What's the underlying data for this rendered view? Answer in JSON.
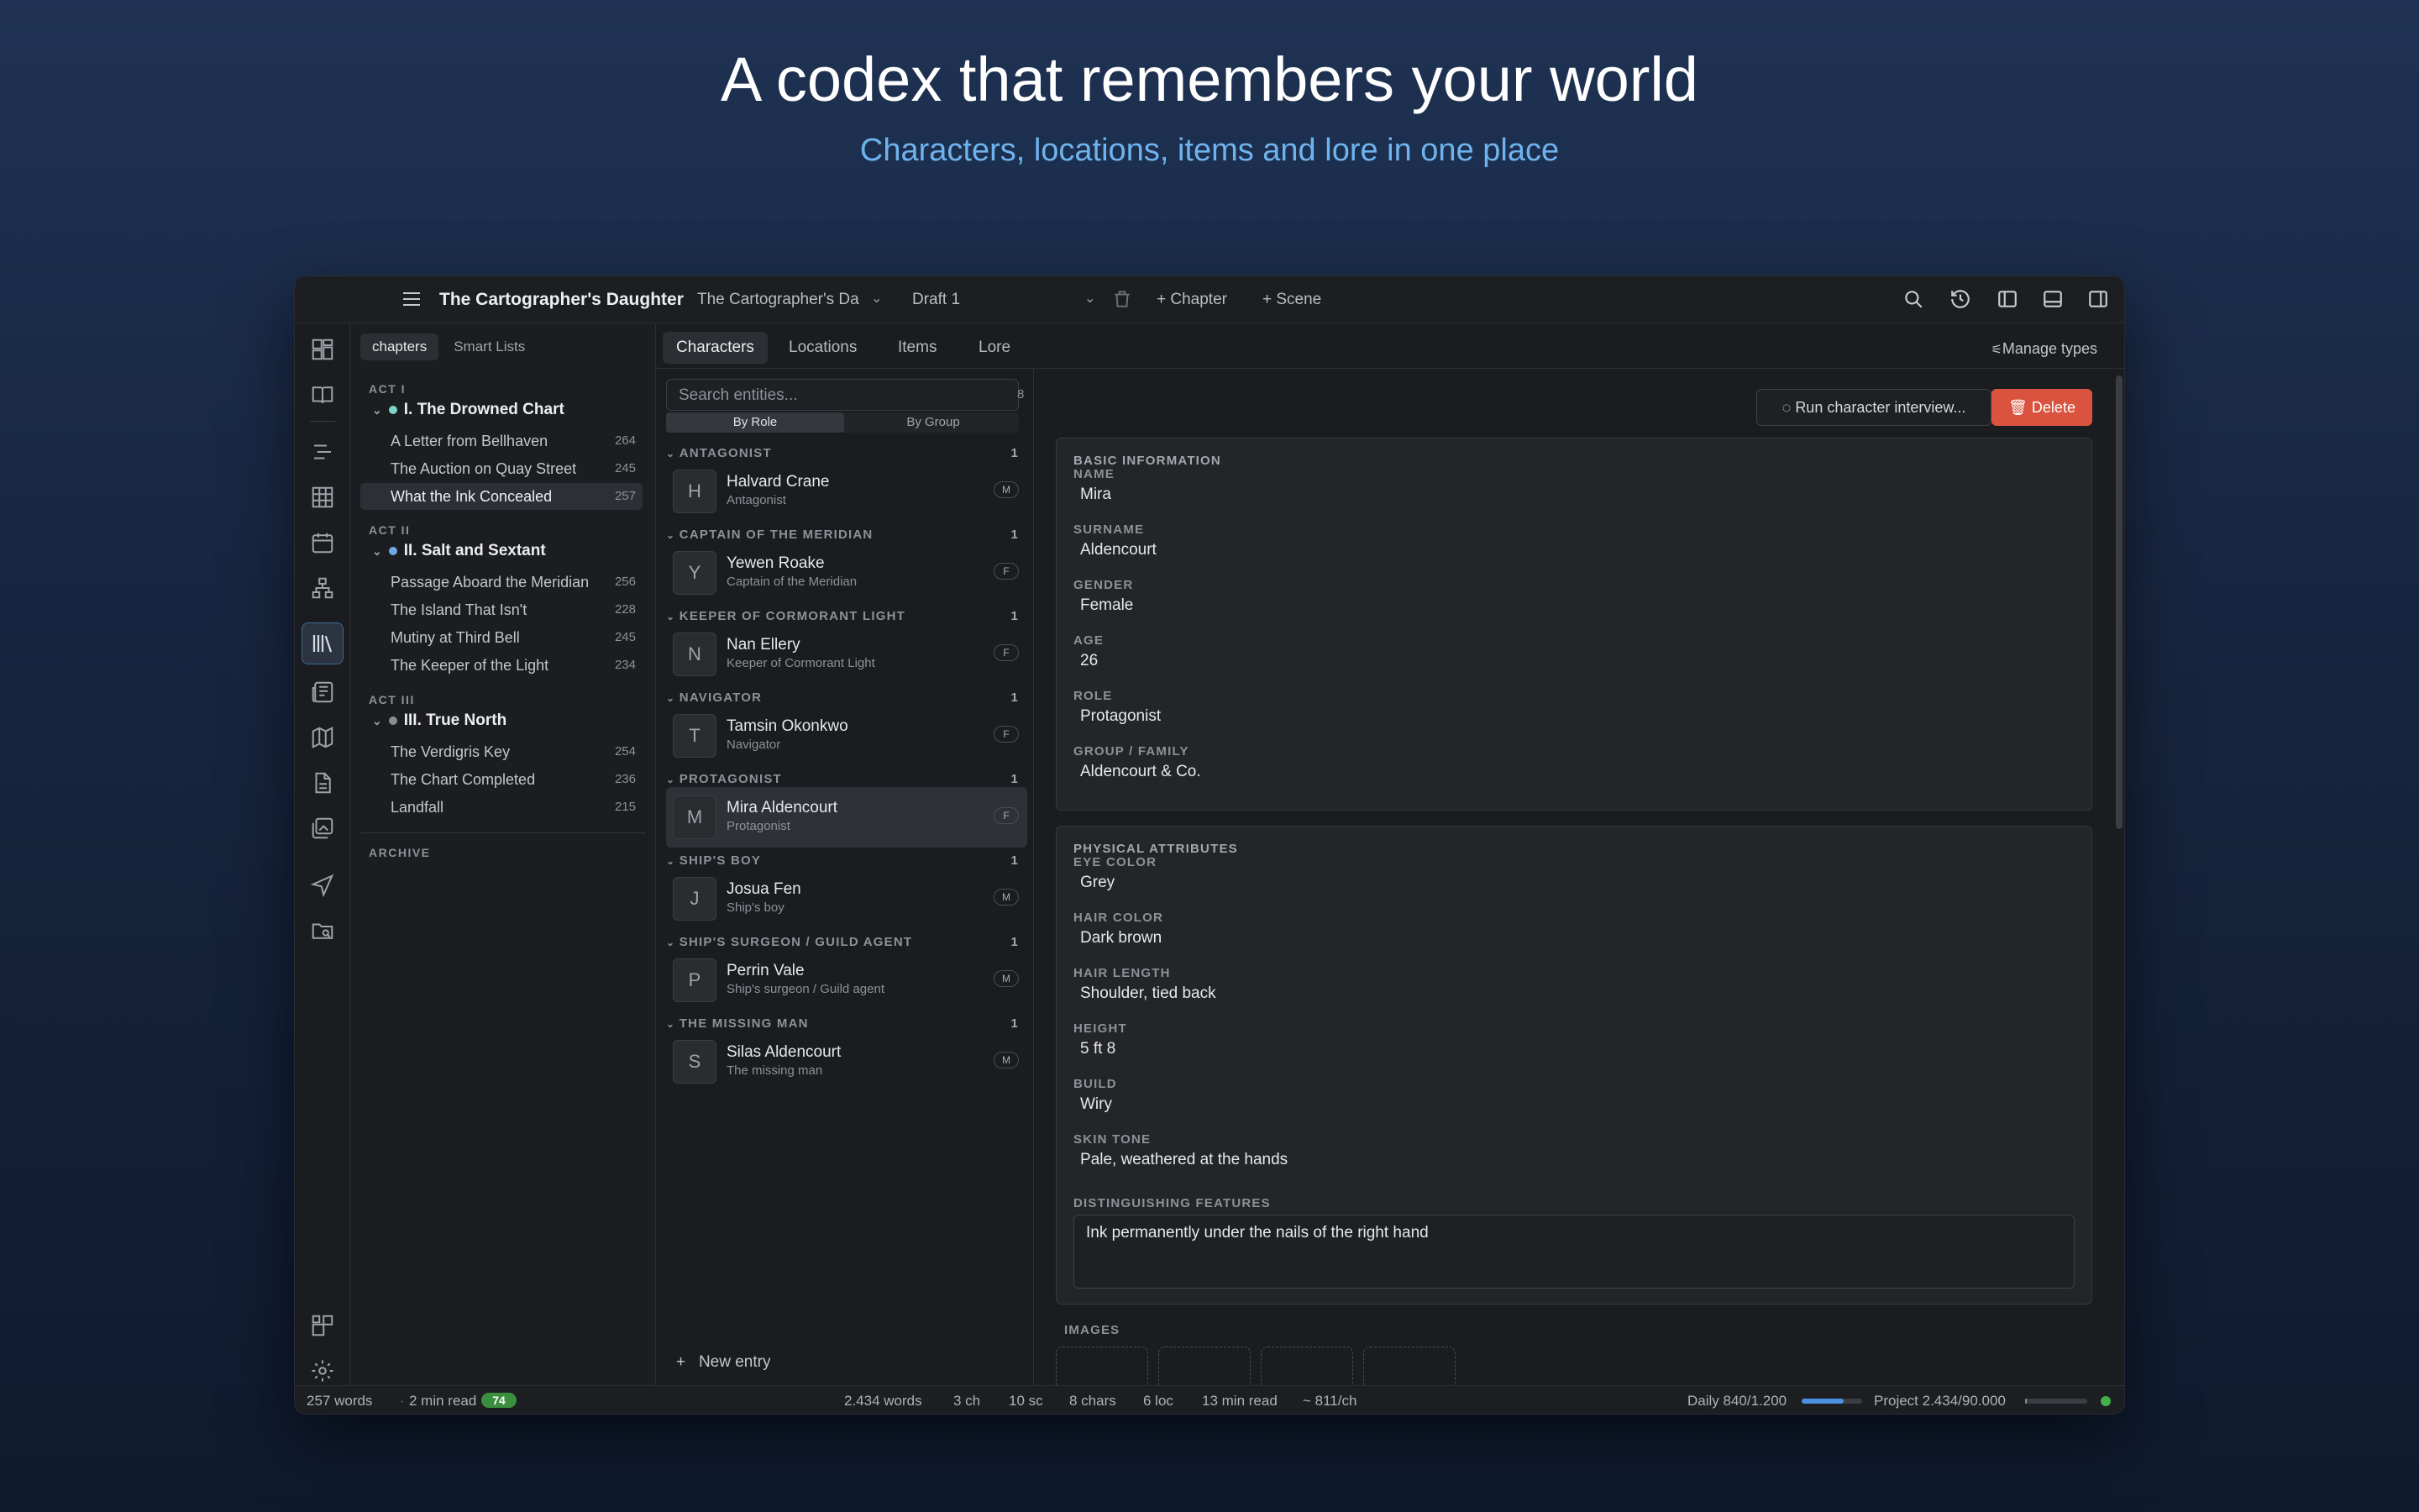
{
  "hero": {
    "title": "A codex that remembers your world",
    "subtitle": "Characters, locations, items and lore in one place"
  },
  "titlebar": {
    "project_title": "The Cartographer's Daughter",
    "book_select": "The Cartographer's Da",
    "draft": "Draft 1",
    "add_chapter": "+ Chapter",
    "add_scene": "+ Scene"
  },
  "chapters_panel": {
    "tabs": [
      "chapters",
      "Smart Lists"
    ],
    "acts": [
      {
        "label": "ACT I",
        "chapter": "I. The Drowned Chart",
        "dot_color": "#7dd3c8",
        "scenes": [
          {
            "title": "A Letter from Bellhaven",
            "words": "264"
          },
          {
            "title": "The Auction on Quay Street",
            "words": "245"
          },
          {
            "title": "What the Ink Concealed",
            "words": "257"
          }
        ]
      },
      {
        "label": "ACT II",
        "chapter": "II. Salt and Sextant",
        "dot_color": "#6fa8e8",
        "scenes": [
          {
            "title": "Passage Aboard the Meridian",
            "words": "256"
          },
          {
            "title": "The Island That Isn't",
            "words": "228"
          },
          {
            "title": "Mutiny at Third Bell",
            "words": "245"
          },
          {
            "title": "The Keeper of the Light",
            "words": "234"
          }
        ]
      },
      {
        "label": "ACT III",
        "chapter": "III. True North",
        "dot_color": "#8a8d93",
        "scenes": [
          {
            "title": "The Verdigris Key",
            "words": "254"
          },
          {
            "title": "The Chart Completed",
            "words": "236"
          },
          {
            "title": "Landfall",
            "words": "215"
          }
        ]
      }
    ],
    "archive_label": "ARCHIVE"
  },
  "entity_tabs": [
    "Characters",
    "Locations",
    "Items",
    "Lore"
  ],
  "manage_types": "Manage types",
  "entity_list": {
    "search_placeholder": "Search entities...",
    "count": "8",
    "group_modes": [
      "By Role",
      "By Group"
    ],
    "groups": [
      {
        "label": "ANTAGONIST",
        "count": "1",
        "entity": {
          "initial": "H",
          "name": "Halvard Crane",
          "role": "Antagonist",
          "gender": "M"
        }
      },
      {
        "label": "CAPTAIN OF THE MERIDIAN",
        "count": "1",
        "entity": {
          "initial": "Y",
          "name": "Yewen Roake",
          "role": "Captain of the Meridian",
          "gender": "F"
        }
      },
      {
        "label": "KEEPER OF CORMORANT LIGHT",
        "count": "1",
        "entity": {
          "initial": "N",
          "name": "Nan Ellery",
          "role": "Keeper of Cormorant Light",
          "gender": "F"
        }
      },
      {
        "label": "NAVIGATOR",
        "count": "1",
        "entity": {
          "initial": "T",
          "name": "Tamsin Okonkwo",
          "role": "Navigator",
          "gender": "F"
        }
      },
      {
        "label": "PROTAGONIST",
        "count": "1",
        "entity": {
          "initial": "M",
          "name": "Mira Aldencourt",
          "role": "Protagonist",
          "gender": "F"
        }
      },
      {
        "label": "SHIP'S BOY",
        "count": "1",
        "entity": {
          "initial": "J",
          "name": "Josua Fen",
          "role": "Ship's boy",
          "gender": "M"
        }
      },
      {
        "label": "SHIP'S SURGEON / GUILD AGENT",
        "count": "1",
        "entity": {
          "initial": "P",
          "name": "Perrin Vale",
          "role": "Ship's surgeon / Guild agent",
          "gender": "M"
        }
      },
      {
        "label": "THE MISSING MAN",
        "count": "1",
        "entity": {
          "initial": "S",
          "name": "Silas Aldencourt",
          "role": "The missing man",
          "gender": "M"
        }
      }
    ],
    "new_entry": "New entry"
  },
  "detail": {
    "interview_button": "Run character interview...",
    "delete_button": "Delete",
    "basic": {
      "title": "BASIC INFORMATION",
      "fields": [
        {
          "label": "NAME",
          "value": "Mira"
        },
        {
          "label": "SURNAME",
          "value": "Aldencourt"
        },
        {
          "label": "GENDER",
          "value": "Female"
        },
        {
          "label": "AGE",
          "value": "26"
        },
        {
          "label": "ROLE",
          "value": "Protagonist"
        },
        {
          "label": "GROUP / FAMILY",
          "value": "Aldencourt & Co."
        }
      ]
    },
    "physical": {
      "title": "PHYSICAL ATTRIBUTES",
      "fields": [
        {
          "label": "EYE COLOR",
          "value": "Grey"
        },
        {
          "label": "HAIR COLOR",
          "value": "Dark brown"
        },
        {
          "label": "HAIR LENGTH",
          "value": "Shoulder, tied back"
        },
        {
          "label": "HEIGHT",
          "value": "5 ft 8"
        },
        {
          "label": "BUILD",
          "value": "Wiry"
        },
        {
          "label": "SKIN TONE",
          "value": "Pale, weathered at the hands"
        }
      ],
      "features_label": "DISTINGUISHING FEATURES",
      "features_value": "Ink permanently under the nails of the right hand"
    },
    "images_label": "IMAGES"
  },
  "statusbar": {
    "scene_words": "257 words",
    "scene_read": "2 min read",
    "badge": "74",
    "project_words": "2.434 words",
    "chapters": "3 ch",
    "scenes": "10 sc",
    "chars": "8 chars",
    "locs": "6 loc",
    "read": "13 min read",
    "per_chapter": "~ 811/ch",
    "daily": "Daily 840/1.200",
    "daily_progress": 0.7,
    "project": "Project 2.434/90.000",
    "project_progress": 0.027
  }
}
